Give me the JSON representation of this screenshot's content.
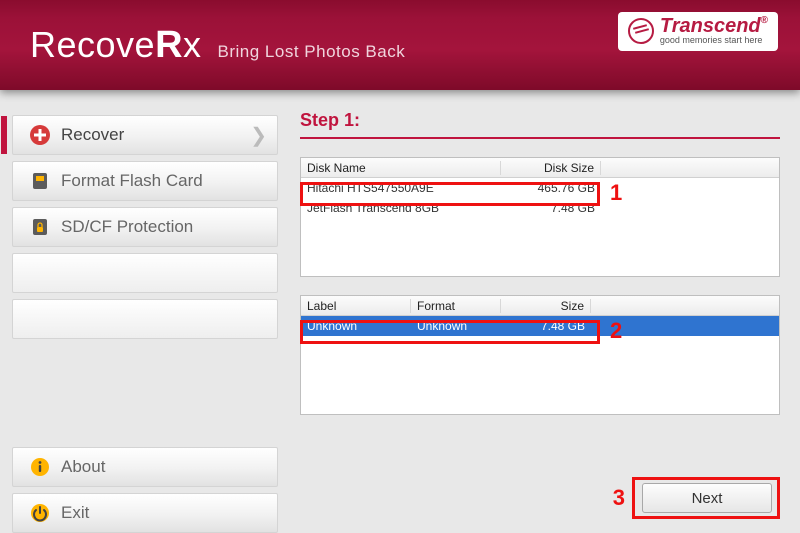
{
  "header": {
    "app_title_a": "Recove",
    "app_title_b": "R",
    "app_title_c": "x",
    "subtitle": "Bring Lost Photos Back",
    "brand_name": "Transcend",
    "brand_tag": "good memories start here"
  },
  "sidebar": {
    "recover": "Recover",
    "format": "Format Flash Card",
    "protect": "SD/CF Protection",
    "about": "About",
    "exit": "Exit"
  },
  "main": {
    "step_title": "Step 1:",
    "disk_headers": {
      "name": "Disk Name",
      "size": "Disk Size"
    },
    "disks": [
      {
        "name": "Hitachi HTS547550A9E",
        "size": "465.76  GB"
      },
      {
        "name": "JetFlash Transcend 8GB",
        "size": "7.48  GB"
      }
    ],
    "partition_headers": {
      "label": "Label",
      "format": "Format",
      "size": "Size"
    },
    "partitions": [
      {
        "label": "Unknown",
        "format": "Unknown",
        "size": "7.48  GB"
      }
    ],
    "next_label": "Next"
  },
  "annotations": {
    "one": "1",
    "two": "2",
    "three": "3"
  }
}
